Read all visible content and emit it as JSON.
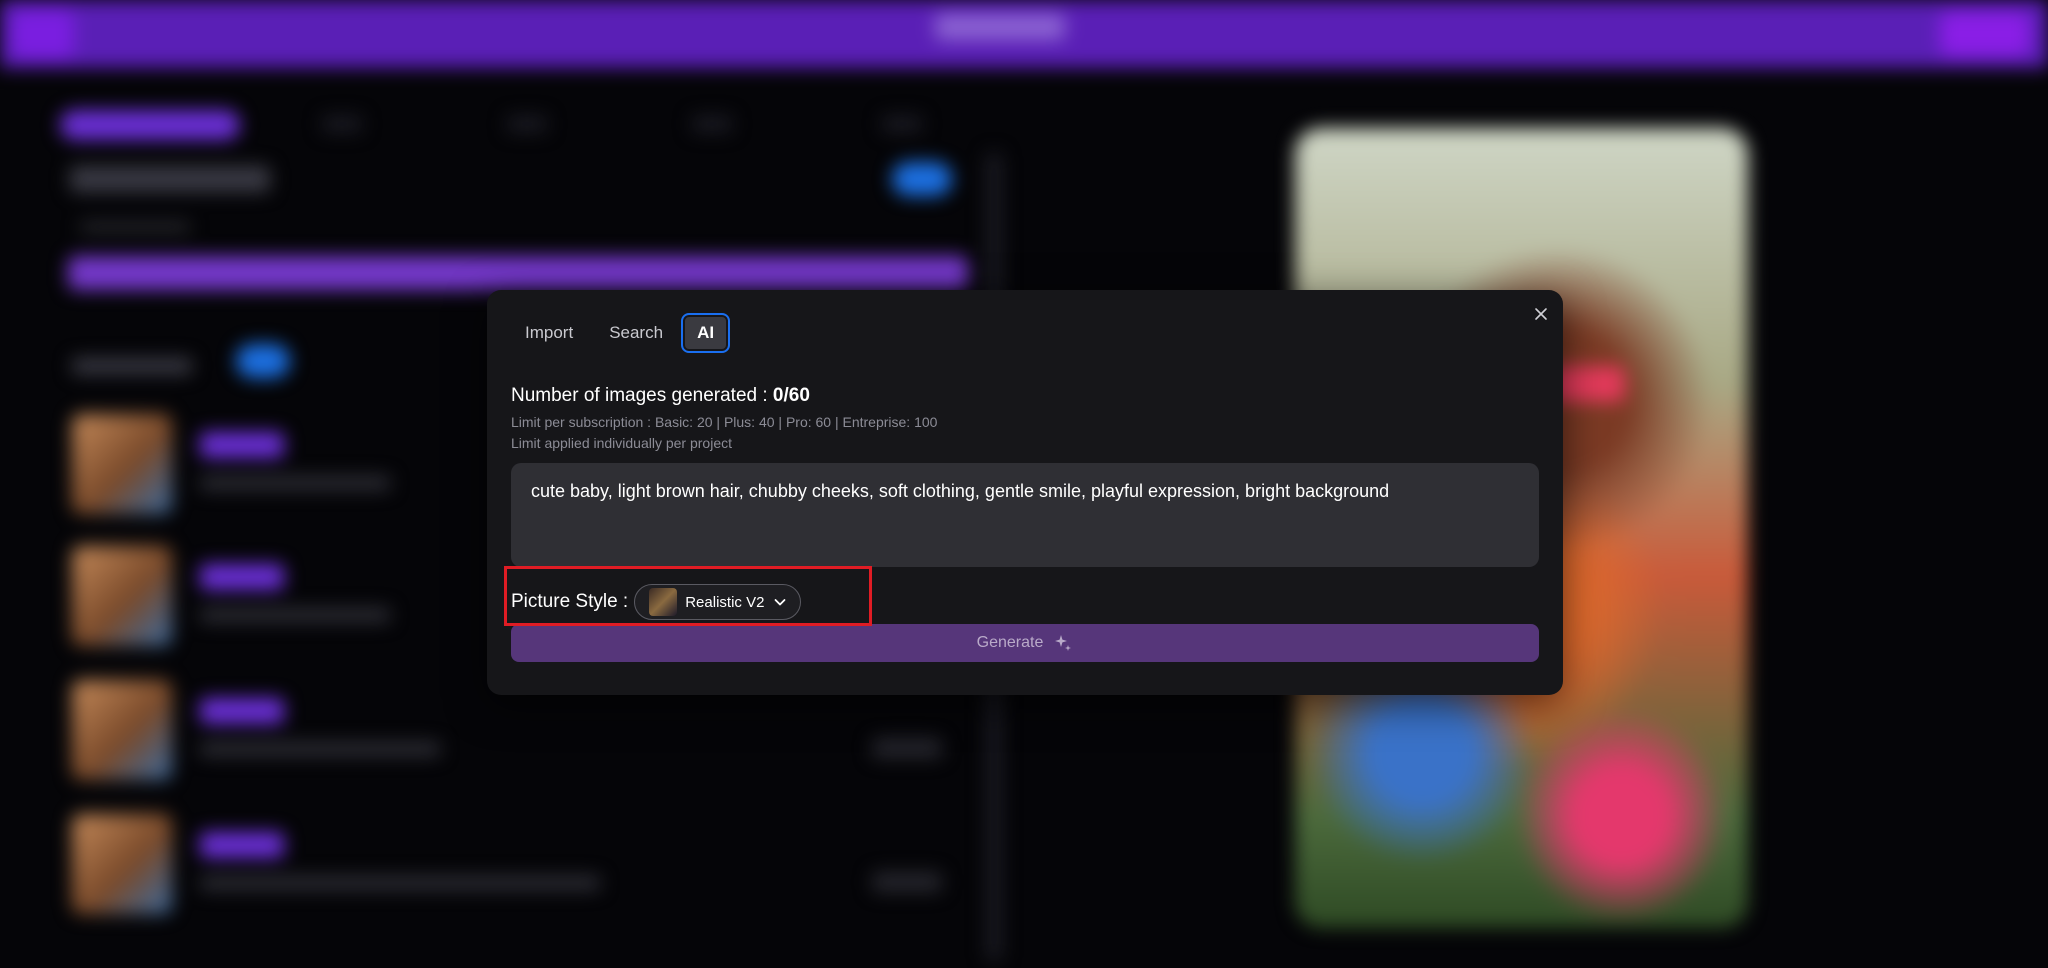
{
  "modal": {
    "tabs": [
      {
        "label": "Import",
        "active": false
      },
      {
        "label": "Search",
        "active": false
      },
      {
        "label": "AI",
        "active": true
      }
    ],
    "count_label": "Number of images generated : ",
    "count_value": "0/60",
    "limit_line1": "Limit per subscription : Basic: 20 | Plus: 40 | Pro: 60 | Entreprise: 100",
    "limit_line2": "Limit applied individually per project",
    "prompt_value": "cute baby, light brown hair, chubby cheeks, soft clothing, gentle smile, playful expression, bright background",
    "picture_style_label": "Picture Style :",
    "picture_style_value": "Realistic V2",
    "generate_label": "Generate"
  },
  "colors": {
    "accent_purple": "#5a1fb6",
    "tab_focus_blue": "#1a6ff0",
    "generate_bg": "#56367a",
    "highlight_red": "#e01c24"
  },
  "icons": {
    "close": "close-icon",
    "chevron": "chevron-down-icon",
    "generate": "sparkle-icon"
  }
}
